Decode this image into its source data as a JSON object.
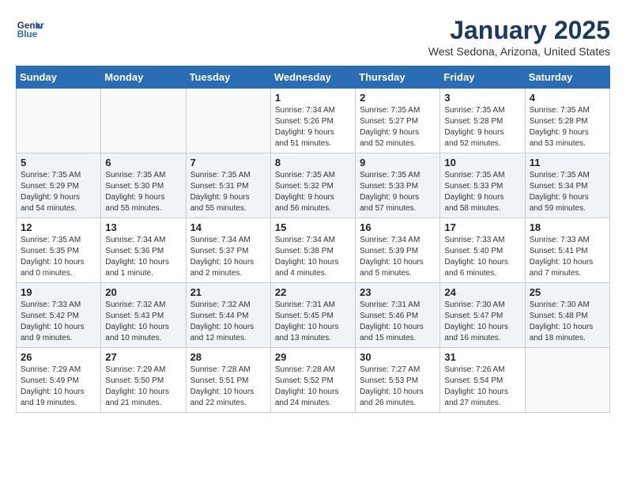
{
  "header": {
    "logo_line1": "General",
    "logo_line2": "Blue",
    "month_title": "January 2025",
    "location": "West Sedona, Arizona, United States"
  },
  "days_of_week": [
    "Sunday",
    "Monday",
    "Tuesday",
    "Wednesday",
    "Thursday",
    "Friday",
    "Saturday"
  ],
  "weeks": [
    [
      {
        "day": "",
        "info": ""
      },
      {
        "day": "",
        "info": ""
      },
      {
        "day": "",
        "info": ""
      },
      {
        "day": "1",
        "info": "Sunrise: 7:34 AM\nSunset: 5:26 PM\nDaylight: 9 hours\nand 51 minutes."
      },
      {
        "day": "2",
        "info": "Sunrise: 7:35 AM\nSunset: 5:27 PM\nDaylight: 9 hours\nand 52 minutes."
      },
      {
        "day": "3",
        "info": "Sunrise: 7:35 AM\nSunset: 5:28 PM\nDaylight: 9 hours\nand 52 minutes."
      },
      {
        "day": "4",
        "info": "Sunrise: 7:35 AM\nSunset: 5:28 PM\nDaylight: 9 hours\nand 53 minutes."
      }
    ],
    [
      {
        "day": "5",
        "info": "Sunrise: 7:35 AM\nSunset: 5:29 PM\nDaylight: 9 hours\nand 54 minutes."
      },
      {
        "day": "6",
        "info": "Sunrise: 7:35 AM\nSunset: 5:30 PM\nDaylight: 9 hours\nand 55 minutes."
      },
      {
        "day": "7",
        "info": "Sunrise: 7:35 AM\nSunset: 5:31 PM\nDaylight: 9 hours\nand 55 minutes."
      },
      {
        "day": "8",
        "info": "Sunrise: 7:35 AM\nSunset: 5:32 PM\nDaylight: 9 hours\nand 56 minutes."
      },
      {
        "day": "9",
        "info": "Sunrise: 7:35 AM\nSunset: 5:33 PM\nDaylight: 9 hours\nand 57 minutes."
      },
      {
        "day": "10",
        "info": "Sunrise: 7:35 AM\nSunset: 5:33 PM\nDaylight: 9 hours\nand 58 minutes."
      },
      {
        "day": "11",
        "info": "Sunrise: 7:35 AM\nSunset: 5:34 PM\nDaylight: 9 hours\nand 59 minutes."
      }
    ],
    [
      {
        "day": "12",
        "info": "Sunrise: 7:35 AM\nSunset: 5:35 PM\nDaylight: 10 hours\nand 0 minutes."
      },
      {
        "day": "13",
        "info": "Sunrise: 7:34 AM\nSunset: 5:36 PM\nDaylight: 10 hours\nand 1 minute."
      },
      {
        "day": "14",
        "info": "Sunrise: 7:34 AM\nSunset: 5:37 PM\nDaylight: 10 hours\nand 2 minutes."
      },
      {
        "day": "15",
        "info": "Sunrise: 7:34 AM\nSunset: 5:38 PM\nDaylight: 10 hours\nand 4 minutes."
      },
      {
        "day": "16",
        "info": "Sunrise: 7:34 AM\nSunset: 5:39 PM\nDaylight: 10 hours\nand 5 minutes."
      },
      {
        "day": "17",
        "info": "Sunrise: 7:33 AM\nSunset: 5:40 PM\nDaylight: 10 hours\nand 6 minutes."
      },
      {
        "day": "18",
        "info": "Sunrise: 7:33 AM\nSunset: 5:41 PM\nDaylight: 10 hours\nand 7 minutes."
      }
    ],
    [
      {
        "day": "19",
        "info": "Sunrise: 7:33 AM\nSunset: 5:42 PM\nDaylight: 10 hours\nand 9 minutes."
      },
      {
        "day": "20",
        "info": "Sunrise: 7:32 AM\nSunset: 5:43 PM\nDaylight: 10 hours\nand 10 minutes."
      },
      {
        "day": "21",
        "info": "Sunrise: 7:32 AM\nSunset: 5:44 PM\nDaylight: 10 hours\nand 12 minutes."
      },
      {
        "day": "22",
        "info": "Sunrise: 7:31 AM\nSunset: 5:45 PM\nDaylight: 10 hours\nand 13 minutes."
      },
      {
        "day": "23",
        "info": "Sunrise: 7:31 AM\nSunset: 5:46 PM\nDaylight: 10 hours\nand 15 minutes."
      },
      {
        "day": "24",
        "info": "Sunrise: 7:30 AM\nSunset: 5:47 PM\nDaylight: 10 hours\nand 16 minutes."
      },
      {
        "day": "25",
        "info": "Sunrise: 7:30 AM\nSunset: 5:48 PM\nDaylight: 10 hours\nand 18 minutes."
      }
    ],
    [
      {
        "day": "26",
        "info": "Sunrise: 7:29 AM\nSunset: 5:49 PM\nDaylight: 10 hours\nand 19 minutes."
      },
      {
        "day": "27",
        "info": "Sunrise: 7:29 AM\nSunset: 5:50 PM\nDaylight: 10 hours\nand 21 minutes."
      },
      {
        "day": "28",
        "info": "Sunrise: 7:28 AM\nSunset: 5:51 PM\nDaylight: 10 hours\nand 22 minutes."
      },
      {
        "day": "29",
        "info": "Sunrise: 7:28 AM\nSunset: 5:52 PM\nDaylight: 10 hours\nand 24 minutes."
      },
      {
        "day": "30",
        "info": "Sunrise: 7:27 AM\nSunset: 5:53 PM\nDaylight: 10 hours\nand 26 minutes."
      },
      {
        "day": "31",
        "info": "Sunrise: 7:26 AM\nSunset: 5:54 PM\nDaylight: 10 hours\nand 27 minutes."
      },
      {
        "day": "",
        "info": ""
      }
    ]
  ]
}
